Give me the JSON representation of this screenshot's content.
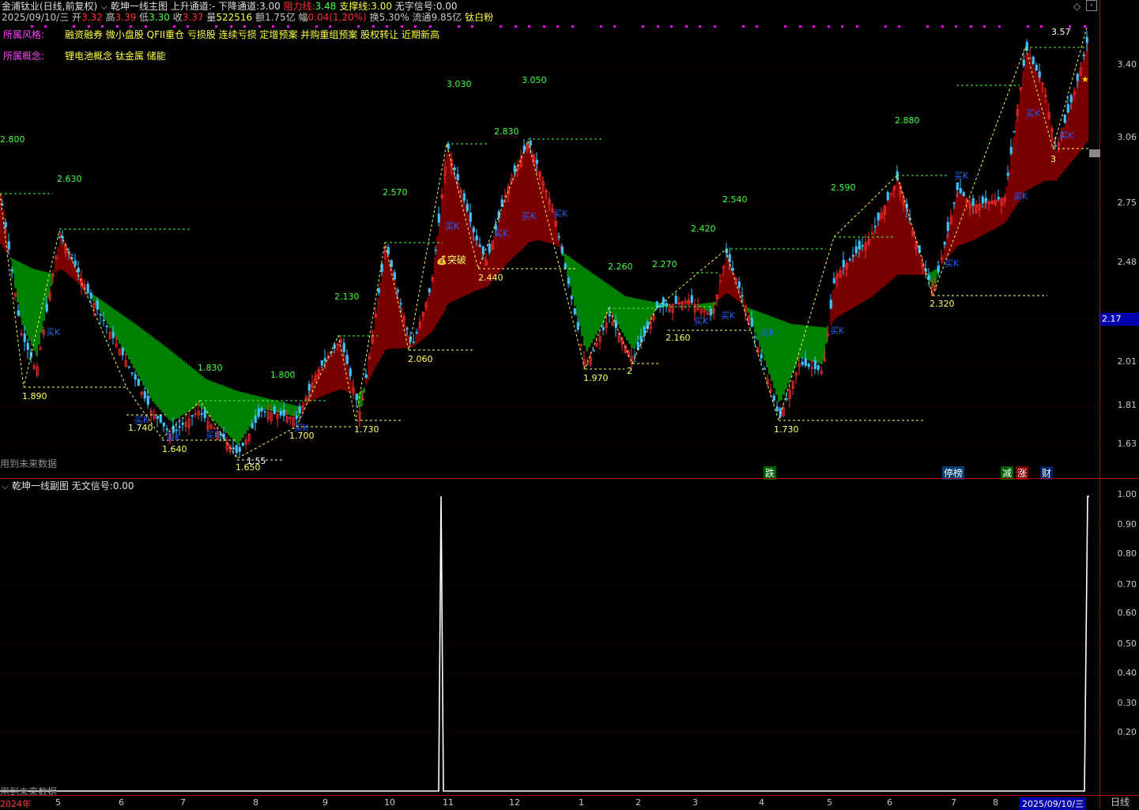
{
  "header": {
    "stock": "金浦钛业(日线,前复权)",
    "indicator_main": "乾坤一线主图",
    "up_channel_label": "上升通道:",
    "up_channel_val": "-",
    "down_channel_label": "下降通道:",
    "down_channel_val": "3.00",
    "resist_label": "阻力线:",
    "resist_val": "3.48",
    "support_label": "支撑线:",
    "support_val": "3.00",
    "nosig_label": "无字信号:",
    "nosig_val": "0.00"
  },
  "quote": {
    "date": "2025/09/10/三",
    "open_label": "开",
    "open": "3.32",
    "high_label": "高",
    "high": "3.39",
    "low_label": "低",
    "low": "3.30",
    "close_label": "收",
    "close": "3.37",
    "vol_label": "量",
    "vol": "522516",
    "amt_label": "额",
    "amt": "1.75亿",
    "chg_label": "幅",
    "chg": "0.04(1.20%)",
    "turn_label": "换",
    "turn": "5.30%",
    "float_label": "流通",
    "float": "9.85亿",
    "tag": "钛白粉"
  },
  "style": {
    "label": "所属风格:",
    "value": "融资融券 微小盘股 QFII重仓 亏损股 连续亏损 定增预案 并购重组预案 股权转让 近期新高"
  },
  "concept": {
    "label": "所属概念:",
    "value": "锂电池概念 钛金属 储能"
  },
  "future_note": "用到未来数据",
  "sub": {
    "title": "乾坤一线副图",
    "nosig_label": "无文信号:",
    "nosig_val": "0.00"
  },
  "price_axis": [
    "3.40",
    "3.06",
    "2.75",
    "2.48",
    "2.17",
    "2.01",
    "1.81",
    "1.63"
  ],
  "price_current": "2.17",
  "sub_axis": [
    "1.00",
    "0.90",
    "0.80",
    "0.70",
    "0.60",
    "0.50",
    "0.40",
    "0.30",
    "0.20"
  ],
  "x_axis": [
    "2024年",
    "5",
    "6",
    "7",
    "8",
    "9",
    "10",
    "11",
    "12",
    "1",
    "2",
    "3",
    "4",
    "5",
    "6",
    "7",
    "8",
    "2025/09/10/三"
  ],
  "period": "日线",
  "levels": [
    {
      "t": "2.800",
      "c": "g"
    },
    {
      "t": "2.630",
      "c": "g"
    },
    {
      "t": "1.890",
      "c": "y"
    },
    {
      "t": "1.740",
      "c": "y"
    },
    {
      "t": "1.640",
      "c": "y"
    },
    {
      "t": "1.830",
      "c": "g"
    },
    {
      "t": "1.55",
      "c": "w"
    },
    {
      "t": "1.650",
      "c": "y"
    },
    {
      "t": "1.800",
      "c": "g"
    },
    {
      "t": "1.700",
      "c": "y"
    },
    {
      "t": "2.130",
      "c": "g"
    },
    {
      "t": "1.730",
      "c": "y"
    },
    {
      "t": "2.570",
      "c": "g"
    },
    {
      "t": "2.060",
      "c": "y"
    },
    {
      "t": "3.030",
      "c": "g"
    },
    {
      "t": "2.830",
      "c": "g"
    },
    {
      "t": "3.050",
      "c": "g"
    },
    {
      "t": "2.440",
      "c": "y"
    },
    {
      "t": "2.260",
      "c": "g"
    },
    {
      "t": "1.970",
      "c": "y"
    },
    {
      "t": "2",
      "c": "y"
    },
    {
      "t": "2.270",
      "c": "g"
    },
    {
      "t": "2.160",
      "c": "y"
    },
    {
      "t": "2.420",
      "c": "g"
    },
    {
      "t": "2.540",
      "c": "g"
    },
    {
      "t": "1.730",
      "c": "y"
    },
    {
      "t": "2.590",
      "c": "g"
    },
    {
      "t": "2.880",
      "c": "g"
    },
    {
      "t": "2.320",
      "c": "y"
    },
    {
      "t": "3.57",
      "c": "w"
    },
    {
      "t": "3",
      "c": "y"
    }
  ],
  "signals": {
    "breakout": "突破",
    "buyk": "买K"
  },
  "event_tags": [
    {
      "t": "跌",
      "bg": "#006000"
    },
    {
      "t": "停榜",
      "bg": "#004070"
    },
    {
      "t": "减",
      "bg": "#006000"
    },
    {
      "t": "涨",
      "bg": "#800000"
    },
    {
      "t": "财",
      "bg": "#002060"
    }
  ],
  "colors": {
    "up": "#ff3030",
    "down": "#40c0ff",
    "green_band": "#008000",
    "red_band": "#7a0000",
    "magenta": "#ff00ff",
    "yellow": "#ffff40",
    "green_text": "#40ff40"
  }
}
